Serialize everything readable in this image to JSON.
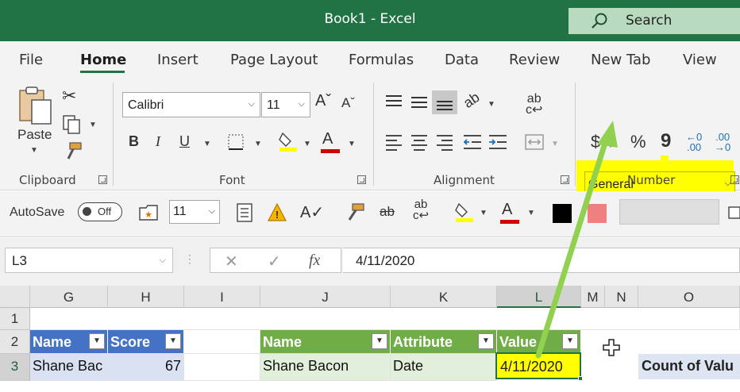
{
  "window": {
    "title": "Book1  -  Excel"
  },
  "search": {
    "placeholder": "Search"
  },
  "menu": {
    "tabs": [
      "File",
      "Home",
      "Insert",
      "Page Layout",
      "Formulas",
      "Data",
      "Review",
      "New Tab",
      "View"
    ],
    "active": "Home"
  },
  "ribbon": {
    "clipboard": {
      "label": "Clipboard",
      "paste_label": "Paste"
    },
    "font": {
      "label": "Font",
      "family": "Calibri",
      "size": "11"
    },
    "alignment": {
      "label": "Alignment"
    },
    "number": {
      "label": "Number",
      "format": "General",
      "currency_symbol": "$",
      "percent_symbol": "%",
      "comma_symbol": "9"
    }
  },
  "qat": {
    "autosave_label": "AutoSave",
    "autosave_state": "Off",
    "font_size": "11",
    "swatch_black": "#000000",
    "swatch_pink": "#f08080"
  },
  "formula_bar": {
    "name_box": "L3",
    "formula": "4/11/2020",
    "cancel_icon": "✕",
    "enter_icon": "✓",
    "fx_icon": "fx"
  },
  "grid": {
    "columns": [
      "G",
      "H",
      "I",
      "J",
      "K",
      "L",
      "M",
      "N",
      "O"
    ],
    "selected_column": "L",
    "rows": [
      "1",
      "2",
      "3"
    ],
    "selected_row": "3",
    "table1": {
      "headers": [
        "Name",
        "Score"
      ],
      "rows": [
        [
          "Shane Bac",
          "67"
        ]
      ]
    },
    "table2": {
      "headers": [
        "Name",
        "Attribute",
        "Value"
      ],
      "rows": [
        [
          "Shane Bacon",
          "Date",
          "4/11/2020"
        ]
      ]
    },
    "pivot_label": "Count of Valu"
  },
  "colors": {
    "excel_green": "#217346",
    "highlight_yellow": "#ffff00",
    "table_blue": "#4472c4",
    "table_green": "#70ad47",
    "arrow_green": "#92d050"
  }
}
